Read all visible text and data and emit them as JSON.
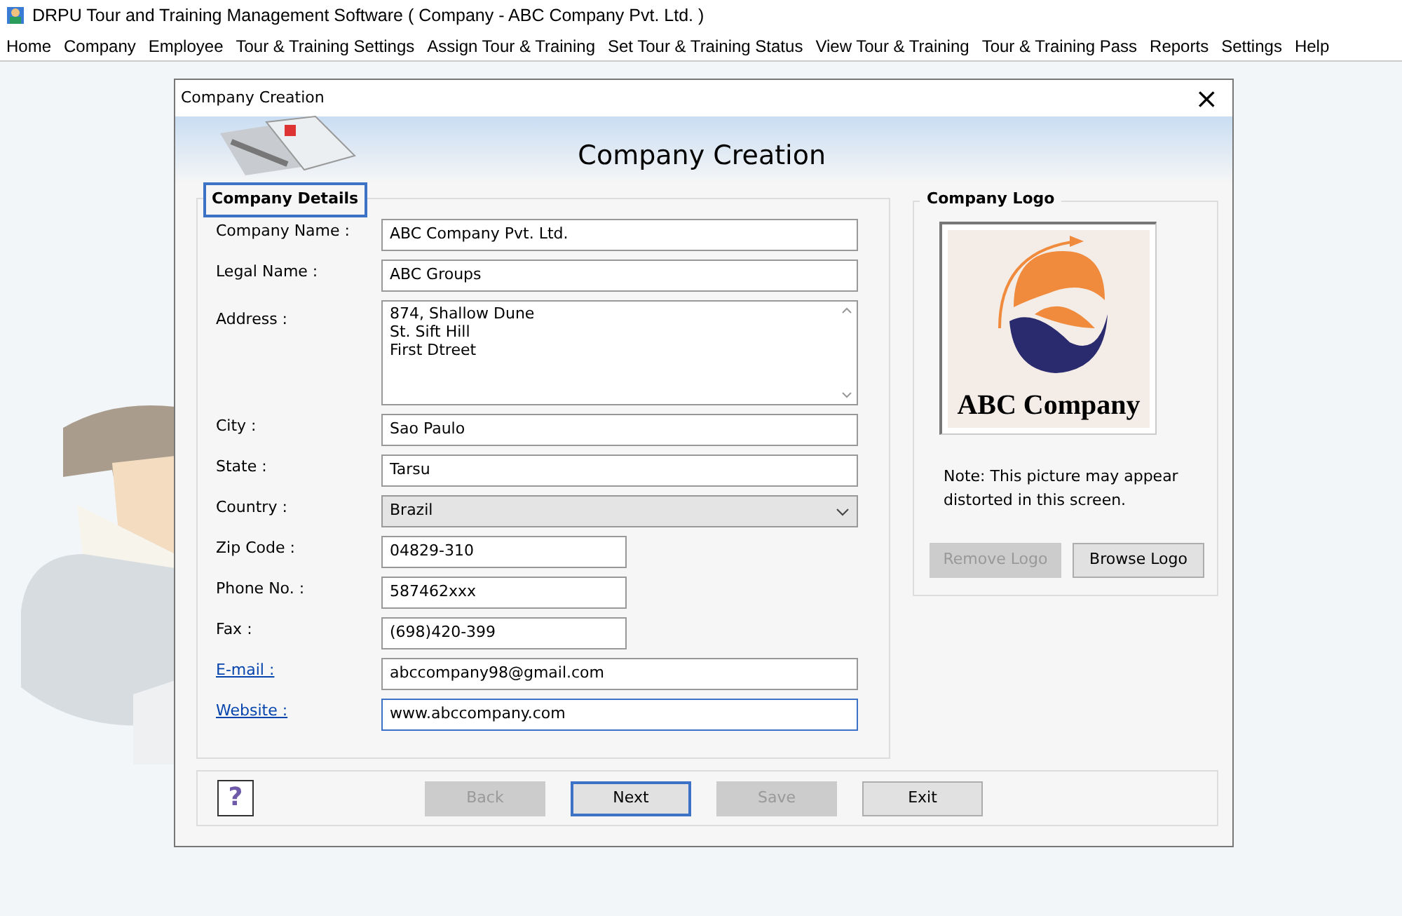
{
  "app_title": "DRPU Tour and Training Management Software ( Company - ABC Company Pvt. Ltd. )",
  "menu": [
    "Home",
    "Company",
    "Employee",
    "Tour & Training Settings",
    "Assign Tour & Training",
    "Set Tour & Training Status",
    "View Tour & Training",
    "Tour & Training Pass",
    "Reports",
    "Settings",
    "Help"
  ],
  "dialog": {
    "title": "Company Creation",
    "close": "×",
    "heading": "Company Creation",
    "details": {
      "legend": "Company Details",
      "fields": [
        {
          "label": "Company Name :",
          "kind": "text",
          "wide": true,
          "link": false,
          "focused": false,
          "value": "ABC Company Pvt. Ltd."
        },
        {
          "label": "Legal Name :",
          "kind": "text",
          "wide": true,
          "link": false,
          "focused": false,
          "value": "ABC Groups"
        },
        {
          "label": "Address :",
          "kind": "textarea",
          "wide": true,
          "link": false,
          "focused": false,
          "value": "874, Shallow Dune\nSt. Sift Hill\nFirst Dtreet"
        },
        {
          "label": "City :",
          "kind": "text",
          "wide": true,
          "link": false,
          "focused": false,
          "value": "Sao Paulo"
        },
        {
          "label": "State :",
          "kind": "text",
          "wide": true,
          "link": false,
          "focused": false,
          "value": "Tarsu"
        },
        {
          "label": "Country :",
          "kind": "select",
          "wide": true,
          "link": false,
          "focused": false,
          "value": "Brazil"
        },
        {
          "label": "Zip Code :",
          "kind": "text",
          "wide": false,
          "link": false,
          "focused": false,
          "value": "04829-310"
        },
        {
          "label": "Phone No. :",
          "kind": "text",
          "wide": false,
          "link": false,
          "focused": false,
          "value": "587462xxx"
        },
        {
          "label": "Fax :",
          "kind": "text",
          "wide": false,
          "link": false,
          "focused": false,
          "value": "(698)420-399"
        },
        {
          "label": "E-mail :",
          "kind": "text",
          "wide": true,
          "link": true,
          "focused": false,
          "value": "abccompany98@gmail.com"
        },
        {
          "label": "Website :",
          "kind": "text",
          "wide": true,
          "link": true,
          "focused": true,
          "value": "www.abccompany.com"
        }
      ]
    },
    "logo": {
      "legend": "Company Logo",
      "logo_text": "ABC Company",
      "note": "Note: This picture may appear distorted in this screen.",
      "buttons": [
        {
          "label": "Remove Logo",
          "disabled": true
        },
        {
          "label": "Browse Logo",
          "disabled": false
        }
      ]
    },
    "help": "?",
    "buttons": [
      {
        "label": "Back",
        "disabled": true,
        "default": false
      },
      {
        "label": "Next",
        "disabled": false,
        "default": true
      },
      {
        "label": "Save",
        "disabled": true,
        "default": false
      },
      {
        "label": "Exit",
        "disabled": false,
        "default": false
      }
    ]
  }
}
